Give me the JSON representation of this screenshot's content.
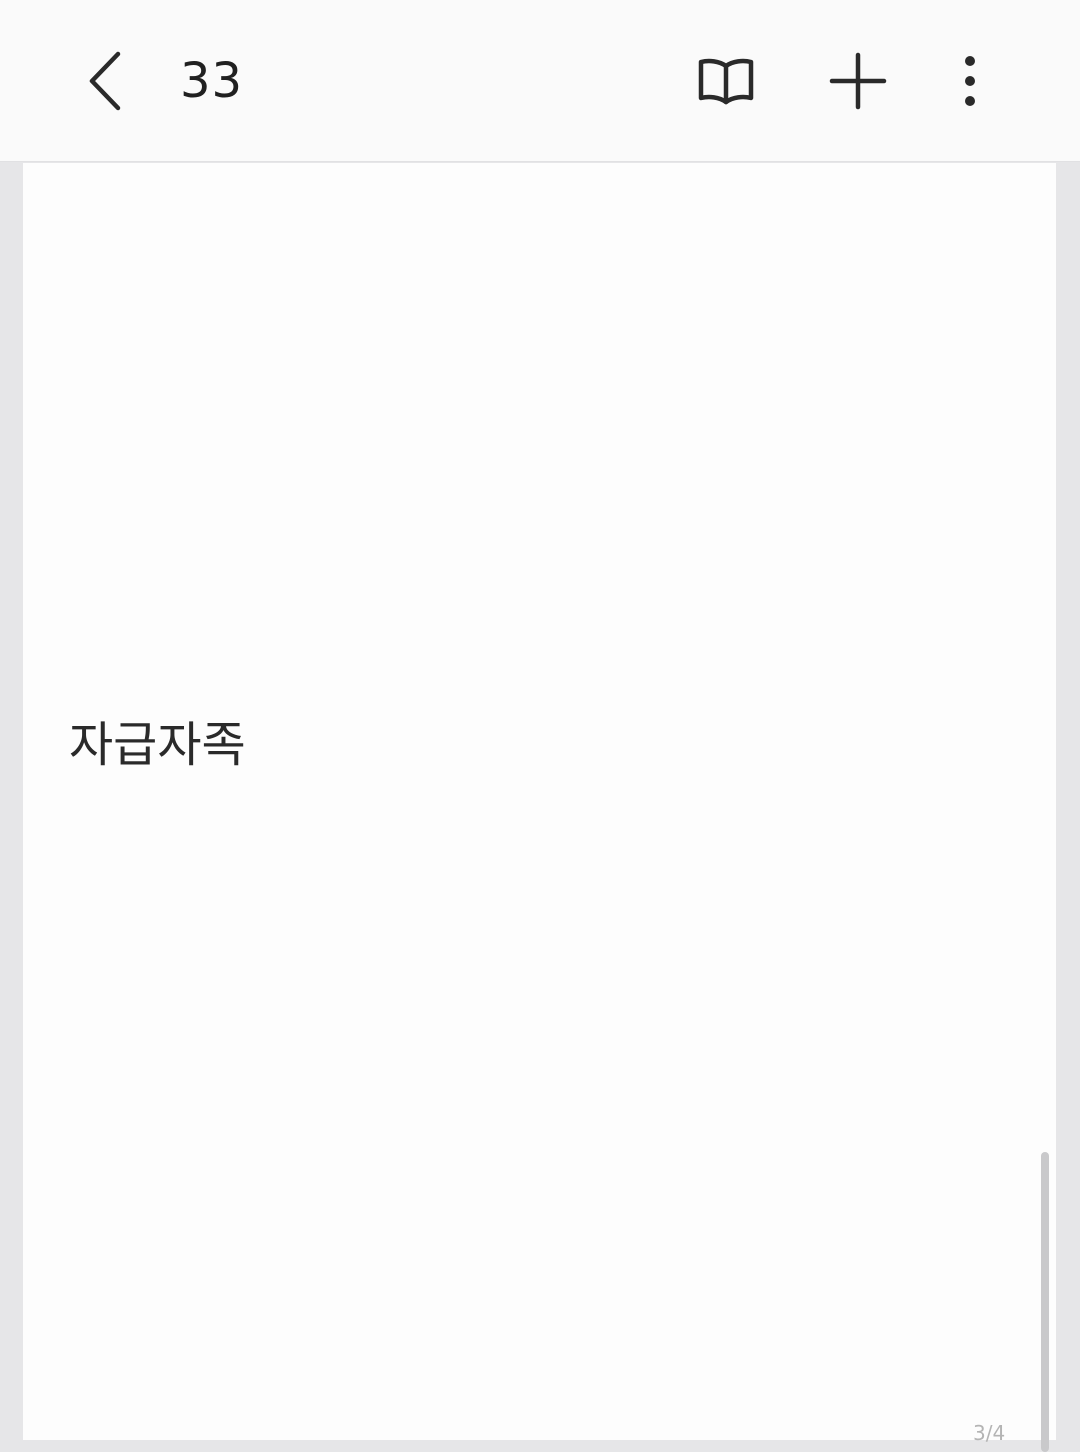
{
  "header": {
    "title": "33",
    "back_icon": "chevron-left-icon",
    "book_icon": "book-open-icon",
    "add_icon": "plus-icon",
    "more_icon": "more-vertical-icon"
  },
  "page": {
    "body_text": "자급자족",
    "indicator": "3/4"
  },
  "colors": {
    "toolbar_bg": "#fafafa",
    "page_bg": "#fdfdfd",
    "outer_bg": "#e6e6e8",
    "text": "#202020",
    "scrollbar": "#c9c9cb"
  }
}
